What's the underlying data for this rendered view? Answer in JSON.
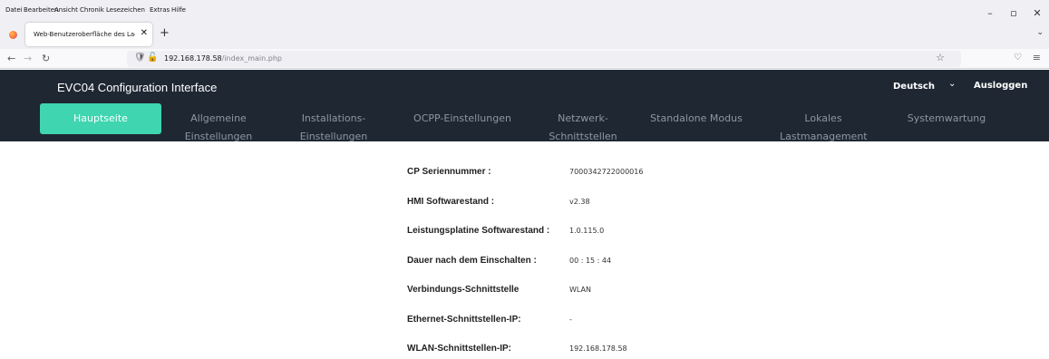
{
  "browser": {
    "menu": [
      "Datei",
      "Bearbeiten",
      "Ansicht",
      "Chronik",
      "Lesezeichen",
      "Extras",
      "Hilfe"
    ],
    "tab_title": "Web-Benutzeroberfläche des Ladeg",
    "url_host": "192.168.178.58",
    "url_path": "/index_main.php"
  },
  "header": {
    "title": "EVC04 Configuration Interface",
    "language": "Deutsch",
    "logout": "Ausloggen"
  },
  "nav": [
    {
      "line1": "Hauptseite",
      "line2": ""
    },
    {
      "line1": "Allgemeine",
      "line2": "Einstellungen"
    },
    {
      "line1": "Installations-",
      "line2": "Einstellungen"
    },
    {
      "line1": "OCPP-Einstellungen",
      "line2": ""
    },
    {
      "line1": "Netzwerk-",
      "line2": "Schnittstellen"
    },
    {
      "line1": "Standalone Modus",
      "line2": ""
    },
    {
      "line1": "Lokales",
      "line2": "Lastmanagement"
    },
    {
      "line1": "Systemwartung",
      "line2": ""
    }
  ],
  "info": [
    {
      "label": "CP Seriennummer :",
      "value": "7000342722000016"
    },
    {
      "label": "HMI Softwarestand :",
      "value": "v2.38"
    },
    {
      "label": "Leistungsplatine Softwarestand :",
      "value": "1.0.115.0"
    },
    {
      "label": "Dauer nach dem Einschalten :",
      "value": "00 : 15 : 44"
    },
    {
      "label": "Verbindungs-Schnittstelle",
      "value": "WLAN"
    },
    {
      "label": "Ethernet-Schnittstellen-IP:",
      "value": "-"
    },
    {
      "label": "WLAN-Schnittstellen-IP:",
      "value": "192.168.178.58"
    }
  ],
  "colors": {
    "header_bg": "#1f2733",
    "active_tab": "#3ed5b0",
    "inactive_tab_text": "#8e96a3"
  }
}
